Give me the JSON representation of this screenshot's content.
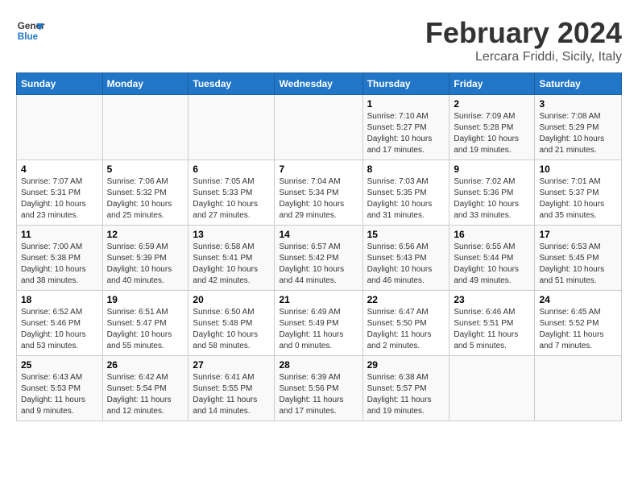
{
  "logo": {
    "line1": "General",
    "line2": "Blue"
  },
  "title": "February 2024",
  "subtitle": "Lercara Friddi, Sicily, Italy",
  "headers": [
    "Sunday",
    "Monday",
    "Tuesday",
    "Wednesday",
    "Thursday",
    "Friday",
    "Saturday"
  ],
  "weeks": [
    [
      {
        "day": "",
        "info": ""
      },
      {
        "day": "",
        "info": ""
      },
      {
        "day": "",
        "info": ""
      },
      {
        "day": "",
        "info": ""
      },
      {
        "day": "1",
        "info": "Sunrise: 7:10 AM\nSunset: 5:27 PM\nDaylight: 10 hours\nand 17 minutes."
      },
      {
        "day": "2",
        "info": "Sunrise: 7:09 AM\nSunset: 5:28 PM\nDaylight: 10 hours\nand 19 minutes."
      },
      {
        "day": "3",
        "info": "Sunrise: 7:08 AM\nSunset: 5:29 PM\nDaylight: 10 hours\nand 21 minutes."
      }
    ],
    [
      {
        "day": "4",
        "info": "Sunrise: 7:07 AM\nSunset: 5:31 PM\nDaylight: 10 hours\nand 23 minutes."
      },
      {
        "day": "5",
        "info": "Sunrise: 7:06 AM\nSunset: 5:32 PM\nDaylight: 10 hours\nand 25 minutes."
      },
      {
        "day": "6",
        "info": "Sunrise: 7:05 AM\nSunset: 5:33 PM\nDaylight: 10 hours\nand 27 minutes."
      },
      {
        "day": "7",
        "info": "Sunrise: 7:04 AM\nSunset: 5:34 PM\nDaylight: 10 hours\nand 29 minutes."
      },
      {
        "day": "8",
        "info": "Sunrise: 7:03 AM\nSunset: 5:35 PM\nDaylight: 10 hours\nand 31 minutes."
      },
      {
        "day": "9",
        "info": "Sunrise: 7:02 AM\nSunset: 5:36 PM\nDaylight: 10 hours\nand 33 minutes."
      },
      {
        "day": "10",
        "info": "Sunrise: 7:01 AM\nSunset: 5:37 PM\nDaylight: 10 hours\nand 35 minutes."
      }
    ],
    [
      {
        "day": "11",
        "info": "Sunrise: 7:00 AM\nSunset: 5:38 PM\nDaylight: 10 hours\nand 38 minutes."
      },
      {
        "day": "12",
        "info": "Sunrise: 6:59 AM\nSunset: 5:39 PM\nDaylight: 10 hours\nand 40 minutes."
      },
      {
        "day": "13",
        "info": "Sunrise: 6:58 AM\nSunset: 5:41 PM\nDaylight: 10 hours\nand 42 minutes."
      },
      {
        "day": "14",
        "info": "Sunrise: 6:57 AM\nSunset: 5:42 PM\nDaylight: 10 hours\nand 44 minutes."
      },
      {
        "day": "15",
        "info": "Sunrise: 6:56 AM\nSunset: 5:43 PM\nDaylight: 10 hours\nand 46 minutes."
      },
      {
        "day": "16",
        "info": "Sunrise: 6:55 AM\nSunset: 5:44 PM\nDaylight: 10 hours\nand 49 minutes."
      },
      {
        "day": "17",
        "info": "Sunrise: 6:53 AM\nSunset: 5:45 PM\nDaylight: 10 hours\nand 51 minutes."
      }
    ],
    [
      {
        "day": "18",
        "info": "Sunrise: 6:52 AM\nSunset: 5:46 PM\nDaylight: 10 hours\nand 53 minutes."
      },
      {
        "day": "19",
        "info": "Sunrise: 6:51 AM\nSunset: 5:47 PM\nDaylight: 10 hours\nand 55 minutes."
      },
      {
        "day": "20",
        "info": "Sunrise: 6:50 AM\nSunset: 5:48 PM\nDaylight: 10 hours\nand 58 minutes."
      },
      {
        "day": "21",
        "info": "Sunrise: 6:49 AM\nSunset: 5:49 PM\nDaylight: 11 hours\nand 0 minutes."
      },
      {
        "day": "22",
        "info": "Sunrise: 6:47 AM\nSunset: 5:50 PM\nDaylight: 11 hours\nand 2 minutes."
      },
      {
        "day": "23",
        "info": "Sunrise: 6:46 AM\nSunset: 5:51 PM\nDaylight: 11 hours\nand 5 minutes."
      },
      {
        "day": "24",
        "info": "Sunrise: 6:45 AM\nSunset: 5:52 PM\nDaylight: 11 hours\nand 7 minutes."
      }
    ],
    [
      {
        "day": "25",
        "info": "Sunrise: 6:43 AM\nSunset: 5:53 PM\nDaylight: 11 hours\nand 9 minutes."
      },
      {
        "day": "26",
        "info": "Sunrise: 6:42 AM\nSunset: 5:54 PM\nDaylight: 11 hours\nand 12 minutes."
      },
      {
        "day": "27",
        "info": "Sunrise: 6:41 AM\nSunset: 5:55 PM\nDaylight: 11 hours\nand 14 minutes."
      },
      {
        "day": "28",
        "info": "Sunrise: 6:39 AM\nSunset: 5:56 PM\nDaylight: 11 hours\nand 17 minutes."
      },
      {
        "day": "29",
        "info": "Sunrise: 6:38 AM\nSunset: 5:57 PM\nDaylight: 11 hours\nand 19 minutes."
      },
      {
        "day": "",
        "info": ""
      },
      {
        "day": "",
        "info": ""
      }
    ]
  ]
}
